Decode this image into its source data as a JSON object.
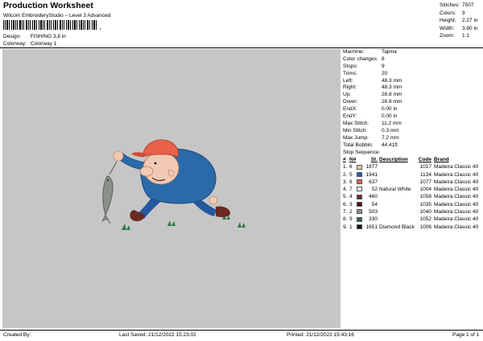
{
  "header": {
    "title": "Production Worksheet",
    "subtitle": "Wilcom EmbroideryStudio – Level 3 Advanced",
    "barcode_suffix": ",",
    "design_label": "Design:",
    "design_value": "FISHING 3,8 in",
    "colorway_label": "Colorway:",
    "colorway_value": "Colorway 1"
  },
  "summary": [
    {
      "label": "Stitches:",
      "value": "7507"
    },
    {
      "label": "Colors:",
      "value": "9"
    },
    {
      "label": "Height:",
      "value": "2.27 in"
    },
    {
      "label": "Width:",
      "value": "3.80 in"
    },
    {
      "label": "Zoom:",
      "value": "1:1"
    }
  ],
  "stats": [
    {
      "label": "Machine:",
      "value": "Tajima"
    },
    {
      "label": "Color changes:",
      "value": "8"
    },
    {
      "label": "Stops:",
      "value": "9"
    },
    {
      "label": "Trims:",
      "value": "20"
    },
    {
      "label": "Left:",
      "value": "48.3 mm"
    },
    {
      "label": "Right:",
      "value": "48.3 mm"
    },
    {
      "label": "Up:",
      "value": "28.8 mm"
    },
    {
      "label": "Down:",
      "value": "28.8 mm"
    },
    {
      "label": "EndX:",
      "value": "0.00 in"
    },
    {
      "label": "EndY:",
      "value": "0.00 in"
    },
    {
      "label": "Max Stitch:",
      "value": "11.2 mm"
    },
    {
      "label": "Min Stitch:",
      "value": "0.3 mm"
    },
    {
      "label": "Max Jump:",
      "value": "7.2 mm"
    },
    {
      "label": "Total Bobbin:",
      "value": "44.41ft"
    }
  ],
  "stop_sequence_label": "Stop Sequence:",
  "stop_columns": [
    "#",
    "N#",
    "St.",
    "Description",
    "Code",
    "Brand"
  ],
  "stops": [
    {
      "num": "1.",
      "n": "6",
      "color": "#f2c9b4",
      "st": "1877",
      "desc": "",
      "code": "1017",
      "brand": "Madeira Classic 40"
    },
    {
      "num": "2.",
      "n": "5",
      "color": "#1f5fa8",
      "st": "1941",
      "desc": "",
      "code": "1134",
      "brand": "Madeira Classic 40"
    },
    {
      "num": "3.",
      "n": "8",
      "color": "#e6604a",
      "st": "637",
      "desc": "",
      "code": "1077",
      "brand": "Madeira Classic 40"
    },
    {
      "num": "4.",
      "n": "7",
      "color": "#f4f4f0",
      "st": "52",
      "desc": "Natural White",
      "code": "1004",
      "brand": "Madeira Classic 40"
    },
    {
      "num": "5.",
      "n": "4",
      "color": "#6b2a24",
      "st": "460",
      "desc": "",
      "code": "1058",
      "brand": "Madeira Classic 40"
    },
    {
      "num": "6.",
      "n": "3",
      "color": "#4a1024",
      "st": "54",
      "desc": "",
      "code": "1035",
      "brand": "Madeira Classic 40"
    },
    {
      "num": "7.",
      "n": "2",
      "color": "#8a9088",
      "st": "503",
      "desc": "",
      "code": "1040",
      "brand": "Madeira Classic 40"
    },
    {
      "num": "8.",
      "n": "9",
      "color": "#2f6648",
      "st": "330",
      "desc": "",
      "code": "1052",
      "brand": "Madeira Classic 40"
    },
    {
      "num": "9.",
      "n": "1",
      "color": "#111111",
      "st": "1651",
      "desc": "Diamond Black",
      "code": "1006",
      "brand": "Madeira Classic 40"
    }
  ],
  "footer": {
    "created": "Created By:",
    "saved": "Last Saved: 21/12/2022 15:23:02",
    "printed": "Printed: 21/12/2022 15:43:16",
    "page": "Page 1 of 1"
  }
}
